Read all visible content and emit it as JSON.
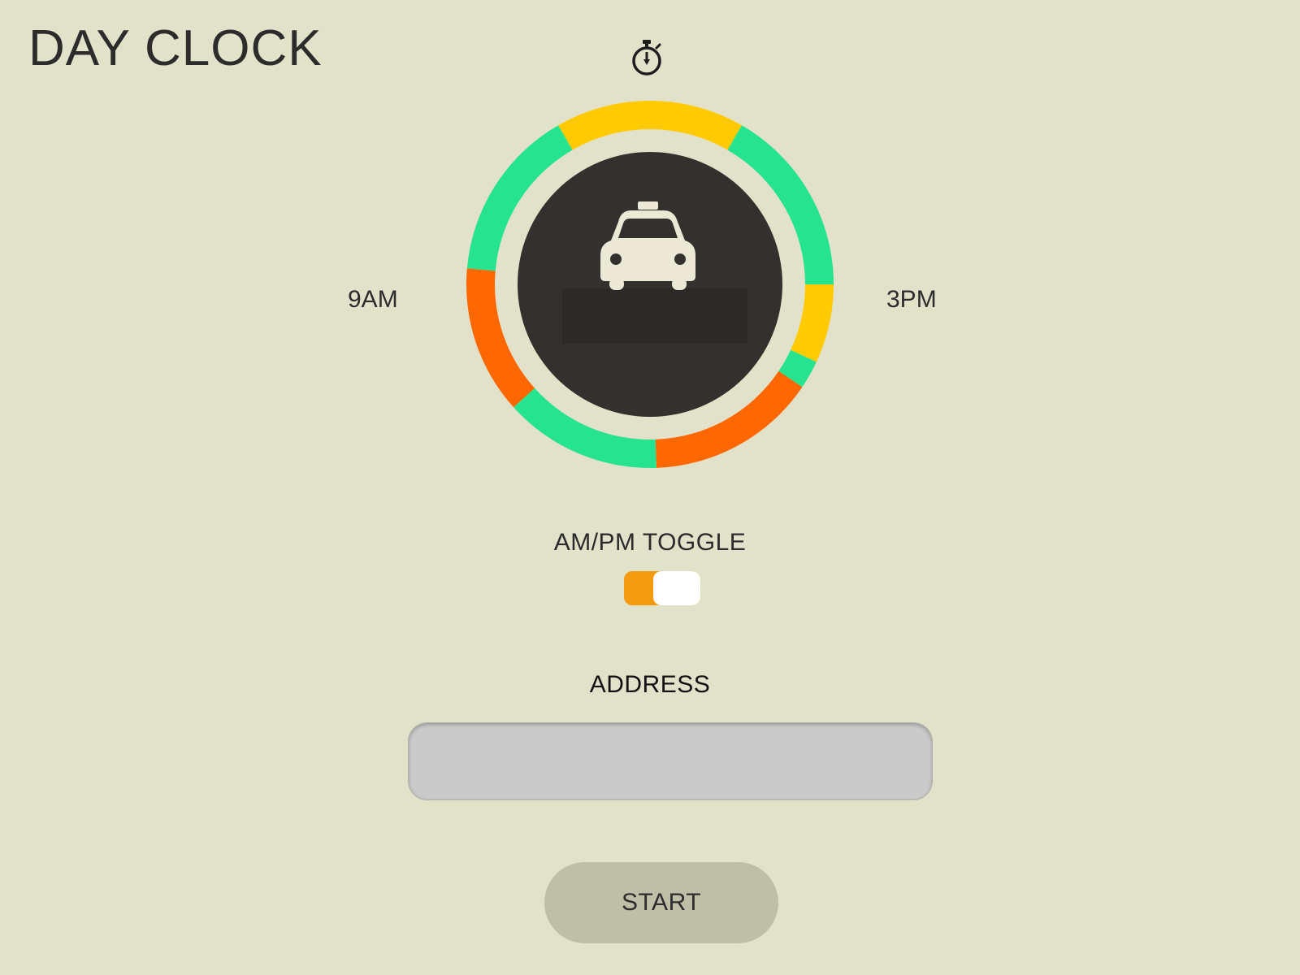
{
  "app": {
    "title": "DAY CLOCK"
  },
  "icons": {
    "timer": "stopwatch-icon",
    "center": "taxi-icon"
  },
  "clock": {
    "left_label": "9AM",
    "right_label": "3PM",
    "center_color": "#34302d",
    "segments": [
      {
        "status": "busy",
        "color": "#ffcb00",
        "start_deg": -30,
        "end_deg": 30
      },
      {
        "status": "clear",
        "color": "#26e38f",
        "start_deg": 30,
        "end_deg": 90
      },
      {
        "status": "busy",
        "color": "#ffcb00",
        "start_deg": 90,
        "end_deg": 115
      },
      {
        "status": "clear",
        "color": "#26e38f",
        "start_deg": 115,
        "end_deg": 124
      },
      {
        "status": "heavy",
        "color": "#ff6800",
        "start_deg": 124,
        "end_deg": 178
      },
      {
        "status": "clear",
        "color": "#26e38f",
        "start_deg": 178,
        "end_deg": 228
      },
      {
        "status": "heavy",
        "color": "#ff6800",
        "start_deg": 228,
        "end_deg": 275
      },
      {
        "status": "clear",
        "color": "#26e38f",
        "start_deg": 275,
        "end_deg": 330
      }
    ]
  },
  "toggle": {
    "label": "AM/PM TOGGLE",
    "state": "PM",
    "on_color": "#f39a0f"
  },
  "address": {
    "label": "ADDRESS",
    "value": "",
    "placeholder": ""
  },
  "start": {
    "label": "START"
  }
}
